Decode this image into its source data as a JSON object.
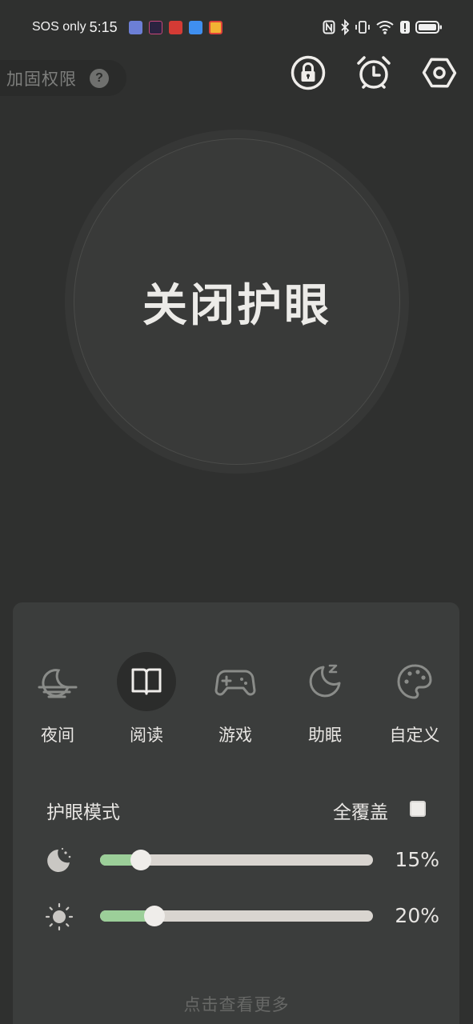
{
  "status_bar": {
    "carrier": "SOS only",
    "time": "5:15",
    "battery_level": 0.9
  },
  "header": {
    "permission_label": "加固权限",
    "help_glyph": "?",
    "icons": [
      "lock-icon",
      "alarm-clock-icon",
      "settings-hex-icon"
    ]
  },
  "main_toggle": {
    "label": "关闭护眼"
  },
  "modes": [
    {
      "label": "夜间",
      "icon": "moon-horizon-icon",
      "active": false
    },
    {
      "label": "阅读",
      "icon": "book-icon",
      "active": true
    },
    {
      "label": "游戏",
      "icon": "gamepad-icon",
      "active": false
    },
    {
      "label": "助眠",
      "icon": "sleep-moon-icon",
      "active": false
    },
    {
      "label": "自定义",
      "icon": "palette-icon",
      "active": false
    }
  ],
  "eye_mode": {
    "title": "护眼模式",
    "full_cover_label": "全覆盖",
    "full_cover_checked": false
  },
  "sliders": [
    {
      "icon": "moon-stars-icon",
      "value": 0.15,
      "value_text": "15%"
    },
    {
      "icon": "sun-brightness-icon",
      "value": 0.2,
      "value_text": "20%"
    }
  ],
  "footer": {
    "more_label": "点击查看更多"
  },
  "colors": {
    "background": "#2f302f",
    "panel": "#3b3d3c",
    "slider_fill": "#9ccf99",
    "slider_track": "#d9d5d0"
  }
}
